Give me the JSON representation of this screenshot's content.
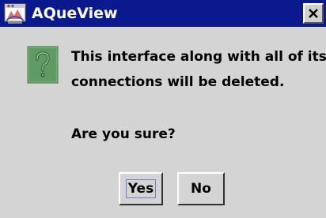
{
  "window": {
    "title": "AQueView",
    "app_icon": "aqueview-app-icon",
    "close_label": "close"
  },
  "dialog": {
    "icon": "question-mark-icon",
    "message_lines": [
      "This interface along with all of its",
      "connections will be deleted."
    ],
    "question": "Are you sure?"
  },
  "buttons": {
    "yes_label": "Yes",
    "no_label": "No",
    "focused": "yes"
  },
  "colors": {
    "titlebar": "#0a1a8e",
    "dialog_background": "#d4d4d4",
    "icon_green": "#5f9a62",
    "focus_ring": "#6e7fc8"
  }
}
